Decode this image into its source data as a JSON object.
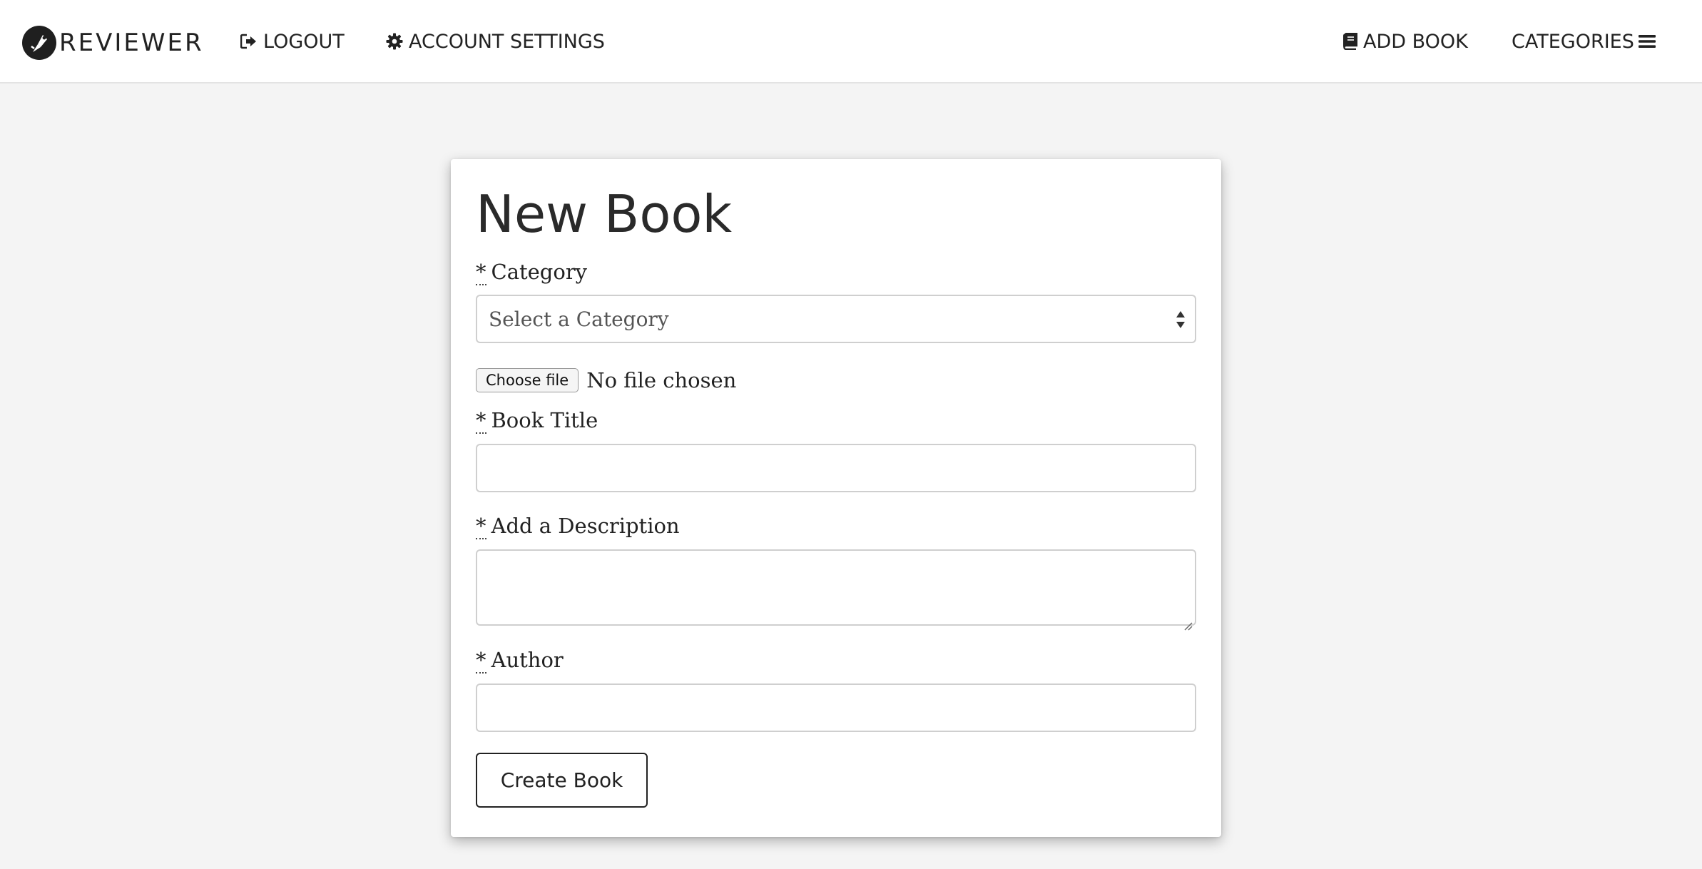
{
  "navbar": {
    "brand": {
      "text": "REVIEWER",
      "logo_icon": "pen-nib-logo"
    },
    "left_links": [
      {
        "label": "LOGOUT",
        "icon": "sign-out-icon"
      },
      {
        "label": "ACCOUNT SETTINGS",
        "icon": "gear-icon"
      }
    ],
    "right_links": [
      {
        "label": "ADD BOOK",
        "icon": "book-icon"
      },
      {
        "label": "CATEGORIES",
        "icon": "hamburger-menu-icon"
      }
    ]
  },
  "form": {
    "title": "New Book",
    "required_marker": "*",
    "category": {
      "label": "Category",
      "selected": "Select a Category",
      "icon": "select-arrows-icon"
    },
    "image_upload": {
      "button_label": "Choose file",
      "status": "No file chosen"
    },
    "book_title": {
      "label": "Book Title",
      "value": ""
    },
    "description": {
      "label": "Add a Description",
      "value": ""
    },
    "author": {
      "label": "Author",
      "value": ""
    },
    "submit_label": "Create Book"
  },
  "colors": {
    "page_background": "#f4f4f4",
    "navbar_background": "#ffffff",
    "card_background": "#ffffff",
    "text": "#222222",
    "input_border": "#cfcfcf"
  }
}
